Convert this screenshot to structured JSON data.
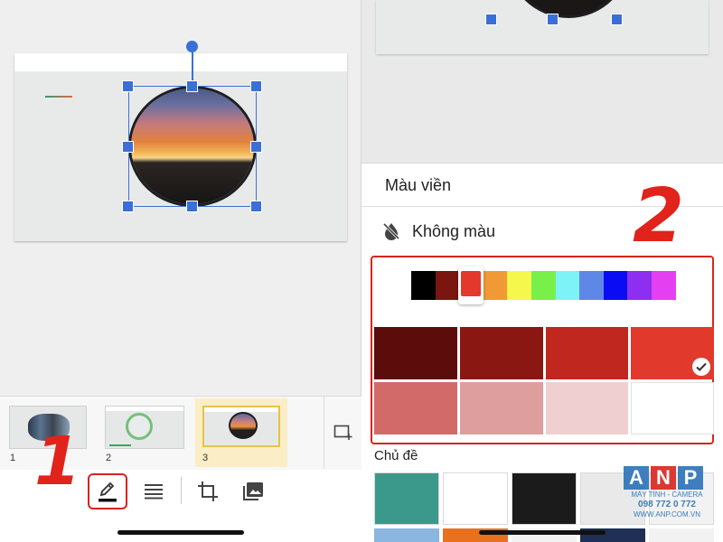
{
  "left": {
    "slides": [
      {
        "number": "1"
      },
      {
        "number": "2"
      },
      {
        "number": "3"
      }
    ],
    "toolbar": {
      "tools": [
        "border-color-tool",
        "border-weight-tool",
        "crop-tool",
        "replace-image-tool"
      ]
    },
    "step_label": "1"
  },
  "right": {
    "sheet_title": "Màu viền",
    "no_color_label": "Không màu",
    "hues": [
      "#000000",
      "#7b1510",
      "#e5382c",
      "#f19a35",
      "#f6f74c",
      "#79f04a",
      "#7ef3f7",
      "#5f87e6",
      "#0a0df4",
      "#8d2ef0",
      "#e53ff2"
    ],
    "selected_hue_index": 2,
    "shades": [
      "#5c0c0a",
      "#8a1712",
      "#bf271f",
      "#e13a2c",
      "#d36a6a",
      "#df9e9e",
      "#efcfcf",
      "#ffffff"
    ],
    "selected_shade_index": 3,
    "theme_label": "Chủ đề",
    "theme_colors": [
      "#3a998a",
      "#ffffff",
      "#1b1b1b",
      "#e9e9e9",
      "#f2f2f2"
    ],
    "theme_colors_row2": [
      "#8ab6e0",
      "#e7711e",
      "#f2f2f2",
      "#1f2f55",
      "#f2f2f2"
    ],
    "step_label": "2"
  },
  "watermark": {
    "letters": [
      "A",
      "N",
      "P"
    ],
    "letter_colors": [
      "#2b72b8",
      "#d9241e",
      "#2b72b8"
    ],
    "line1": "MÁY TÍNH - CAMERA",
    "line2": "098 772 0 772",
    "line3": "WWW.ANP.COM.VN"
  },
  "colors": {
    "accent_blue": "#3b6fd8",
    "highlight_red": "#d9241e"
  }
}
